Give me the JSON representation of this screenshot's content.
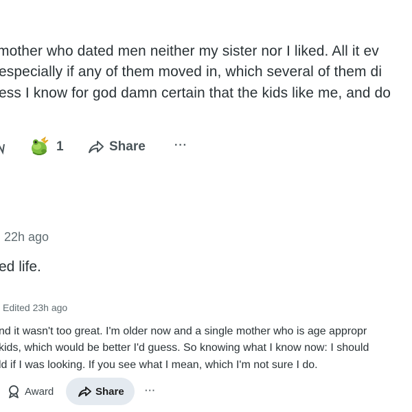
{
  "post": {
    "lines": [
      "mother who dated men neither my sister nor I liked. All it ev",
      "especially if any of them moved in, which several of them di",
      "ess I know for god damn certain that the kids like me, and do"
    ],
    "actions": {
      "award_count": "1",
      "share_label": "Share",
      "more_label": "···"
    }
  },
  "comment": {
    "timestamp": "22h ago",
    "text": "ed life."
  },
  "reply": {
    "timestamp": "Edited 23h ago",
    "lines": [
      "nd it wasn't too great. I'm older now and a single mother who is age appropr",
      "kids, which would be better I'd guess. So knowing what I know now: I should",
      "ld if I was looking. If you see what I mean, which I'm not sure I do."
    ],
    "actions": {
      "award_label": "Award",
      "share_label": "Share",
      "more_label": "···"
    }
  },
  "colors": {
    "text": "#2a3236",
    "meta": "#5f6b70",
    "share_pill_bg": "#e4eaf0"
  },
  "icons": [
    "award-emoji-icon",
    "share-arrow-icon",
    "more-dots-icon",
    "award-ribbon-icon"
  ]
}
